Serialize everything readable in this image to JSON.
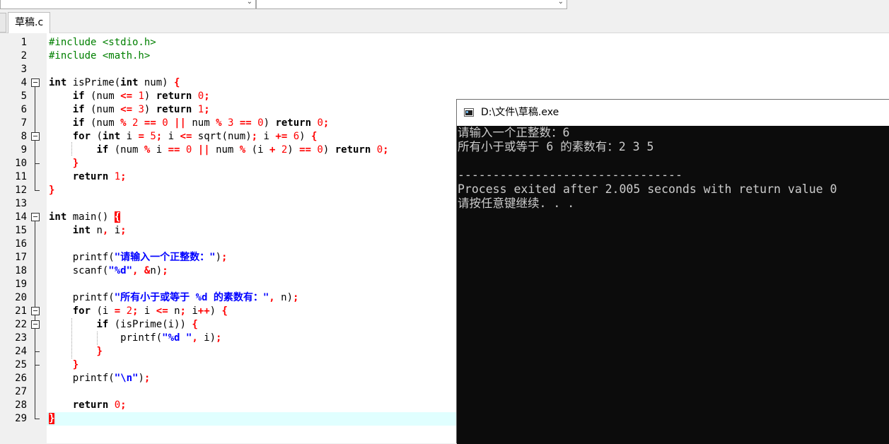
{
  "editor": {
    "tab_label": "草稿.c",
    "current_line": 29,
    "lines": [
      {
        "n": "1",
        "t": [
          [
            "pp",
            "#include <stdio.h>"
          ]
        ]
      },
      {
        "n": "2",
        "t": [
          [
            "pp",
            "#include <math.h>"
          ]
        ]
      },
      {
        "n": "3",
        "t": []
      },
      {
        "n": "4",
        "t": [
          [
            "kw",
            "int"
          ],
          [
            "pl",
            " isPrime("
          ],
          [
            "kw",
            "int"
          ],
          [
            "pl",
            " num) "
          ],
          [
            "sym",
            "{"
          ]
        ]
      },
      {
        "n": "5",
        "t": [
          [
            "pl",
            "    "
          ],
          [
            "kw",
            "if"
          ],
          [
            "pl",
            " (num "
          ],
          [
            "sym",
            "<="
          ],
          [
            "pl",
            " "
          ],
          [
            "num",
            "1"
          ],
          [
            "pl",
            ") "
          ],
          [
            "kw",
            "return"
          ],
          [
            "pl",
            " "
          ],
          [
            "num",
            "0"
          ],
          [
            "sym",
            ";"
          ]
        ]
      },
      {
        "n": "6",
        "t": [
          [
            "pl",
            "    "
          ],
          [
            "kw",
            "if"
          ],
          [
            "pl",
            " (num "
          ],
          [
            "sym",
            "<="
          ],
          [
            "pl",
            " "
          ],
          [
            "num",
            "3"
          ],
          [
            "pl",
            ") "
          ],
          [
            "kw",
            "return"
          ],
          [
            "pl",
            " "
          ],
          [
            "num",
            "1"
          ],
          [
            "sym",
            ";"
          ]
        ]
      },
      {
        "n": "7",
        "t": [
          [
            "pl",
            "    "
          ],
          [
            "kw",
            "if"
          ],
          [
            "pl",
            " (num "
          ],
          [
            "sym",
            "%"
          ],
          [
            "pl",
            " "
          ],
          [
            "num",
            "2"
          ],
          [
            "pl",
            " "
          ],
          [
            "sym",
            "=="
          ],
          [
            "pl",
            " "
          ],
          [
            "num",
            "0"
          ],
          [
            "pl",
            " "
          ],
          [
            "sym",
            "||"
          ],
          [
            "pl",
            " num "
          ],
          [
            "sym",
            "%"
          ],
          [
            "pl",
            " "
          ],
          [
            "num",
            "3"
          ],
          [
            "pl",
            " "
          ],
          [
            "sym",
            "=="
          ],
          [
            "pl",
            " "
          ],
          [
            "num",
            "0"
          ],
          [
            "pl",
            ") "
          ],
          [
            "kw",
            "return"
          ],
          [
            "pl",
            " "
          ],
          [
            "num",
            "0"
          ],
          [
            "sym",
            ";"
          ]
        ]
      },
      {
        "n": "8",
        "t": [
          [
            "pl",
            "    "
          ],
          [
            "kw",
            "for"
          ],
          [
            "pl",
            " ("
          ],
          [
            "kw",
            "int"
          ],
          [
            "pl",
            " i "
          ],
          [
            "sym",
            "="
          ],
          [
            "pl",
            " "
          ],
          [
            "num",
            "5"
          ],
          [
            "sym",
            ";"
          ],
          [
            "pl",
            " i "
          ],
          [
            "sym",
            "<="
          ],
          [
            "pl",
            " sqrt(num)"
          ],
          [
            "sym",
            ";"
          ],
          [
            "pl",
            " i "
          ],
          [
            "sym",
            "+="
          ],
          [
            "pl",
            " "
          ],
          [
            "num",
            "6"
          ],
          [
            "pl",
            ") "
          ],
          [
            "sym",
            "{"
          ]
        ]
      },
      {
        "n": "9",
        "t": [
          [
            "pl",
            "        "
          ],
          [
            "kw",
            "if"
          ],
          [
            "pl",
            " (num "
          ],
          [
            "sym",
            "%"
          ],
          [
            "pl",
            " i "
          ],
          [
            "sym",
            "=="
          ],
          [
            "pl",
            " "
          ],
          [
            "num",
            "0"
          ],
          [
            "pl",
            " "
          ],
          [
            "sym",
            "||"
          ],
          [
            "pl",
            " num "
          ],
          [
            "sym",
            "%"
          ],
          [
            "pl",
            " (i "
          ],
          [
            "sym",
            "+"
          ],
          [
            "pl",
            " "
          ],
          [
            "num",
            "2"
          ],
          [
            "pl",
            ") "
          ],
          [
            "sym",
            "=="
          ],
          [
            "pl",
            " "
          ],
          [
            "num",
            "0"
          ],
          [
            "pl",
            ") "
          ],
          [
            "kw",
            "return"
          ],
          [
            "pl",
            " "
          ],
          [
            "num",
            "0"
          ],
          [
            "sym",
            ";"
          ]
        ]
      },
      {
        "n": "10",
        "t": [
          [
            "pl",
            "    "
          ],
          [
            "sym",
            "}"
          ]
        ]
      },
      {
        "n": "11",
        "t": [
          [
            "pl",
            "    "
          ],
          [
            "kw",
            "return"
          ],
          [
            "pl",
            " "
          ],
          [
            "num",
            "1"
          ],
          [
            "sym",
            ";"
          ]
        ]
      },
      {
        "n": "12",
        "t": [
          [
            "sym",
            "}"
          ]
        ]
      },
      {
        "n": "13",
        "t": []
      },
      {
        "n": "14",
        "t": [
          [
            "kw",
            "int"
          ],
          [
            "pl",
            " main() "
          ],
          [
            "hl",
            "{"
          ]
        ]
      },
      {
        "n": "15",
        "t": [
          [
            "pl",
            "    "
          ],
          [
            "kw",
            "int"
          ],
          [
            "pl",
            " n"
          ],
          [
            "sym",
            ","
          ],
          [
            "pl",
            " i"
          ],
          [
            "sym",
            ";"
          ]
        ]
      },
      {
        "n": "16",
        "t": []
      },
      {
        "n": "17",
        "t": [
          [
            "pl",
            "    printf("
          ],
          [
            "str",
            "\"请输入一个正整数：\""
          ],
          [
            "pl",
            ")"
          ],
          [
            "sym",
            ";"
          ]
        ]
      },
      {
        "n": "18",
        "t": [
          [
            "pl",
            "    scanf("
          ],
          [
            "str",
            "\"%d\""
          ],
          [
            "sym",
            ","
          ],
          [
            "pl",
            " "
          ],
          [
            "sym",
            "&"
          ],
          [
            "pl",
            "n)"
          ],
          [
            "sym",
            ";"
          ]
        ]
      },
      {
        "n": "19",
        "t": []
      },
      {
        "n": "20",
        "t": [
          [
            "pl",
            "    printf("
          ],
          [
            "str",
            "\"所有小于或等于 %d 的素数有：\""
          ],
          [
            "sym",
            ","
          ],
          [
            "pl",
            " n)"
          ],
          [
            "sym",
            ";"
          ]
        ]
      },
      {
        "n": "21",
        "t": [
          [
            "pl",
            "    "
          ],
          [
            "kw",
            "for"
          ],
          [
            "pl",
            " (i "
          ],
          [
            "sym",
            "="
          ],
          [
            "pl",
            " "
          ],
          [
            "num",
            "2"
          ],
          [
            "sym",
            ";"
          ],
          [
            "pl",
            " i "
          ],
          [
            "sym",
            "<="
          ],
          [
            "pl",
            " n"
          ],
          [
            "sym",
            ";"
          ],
          [
            "pl",
            " i"
          ],
          [
            "sym",
            "++"
          ],
          [
            "pl",
            ") "
          ],
          [
            "sym",
            "{"
          ]
        ]
      },
      {
        "n": "22",
        "t": [
          [
            "pl",
            "        "
          ],
          [
            "kw",
            "if"
          ],
          [
            "pl",
            " (isPrime(i)) "
          ],
          [
            "sym",
            "{"
          ]
        ]
      },
      {
        "n": "23",
        "t": [
          [
            "pl",
            "            printf("
          ],
          [
            "str",
            "\"%d \""
          ],
          [
            "sym",
            ","
          ],
          [
            "pl",
            " i)"
          ],
          [
            "sym",
            ";"
          ]
        ]
      },
      {
        "n": "24",
        "t": [
          [
            "pl",
            "        "
          ],
          [
            "sym",
            "}"
          ]
        ]
      },
      {
        "n": "25",
        "t": [
          [
            "pl",
            "    "
          ],
          [
            "sym",
            "}"
          ]
        ]
      },
      {
        "n": "26",
        "t": [
          [
            "pl",
            "    printf("
          ],
          [
            "str",
            "\"\\n\""
          ],
          [
            "pl",
            ")"
          ],
          [
            "sym",
            ";"
          ]
        ]
      },
      {
        "n": "27",
        "t": []
      },
      {
        "n": "28",
        "t": [
          [
            "pl",
            "    "
          ],
          [
            "kw",
            "return"
          ],
          [
            "pl",
            " "
          ],
          [
            "num",
            "0"
          ],
          [
            "sym",
            ";"
          ]
        ]
      },
      {
        "n": "29",
        "t": [
          [
            "hl",
            "}"
          ]
        ]
      }
    ]
  },
  "console": {
    "title": "D:\\文件\\草稿.exe",
    "lines": [
      "请输入一个正整数：6",
      "所有小于或等于 6 的素数有：2 3 5",
      "",
      "--------------------------------",
      "Process exited after 2.005 seconds with return value 0",
      "请按任意键继续. . ."
    ]
  }
}
